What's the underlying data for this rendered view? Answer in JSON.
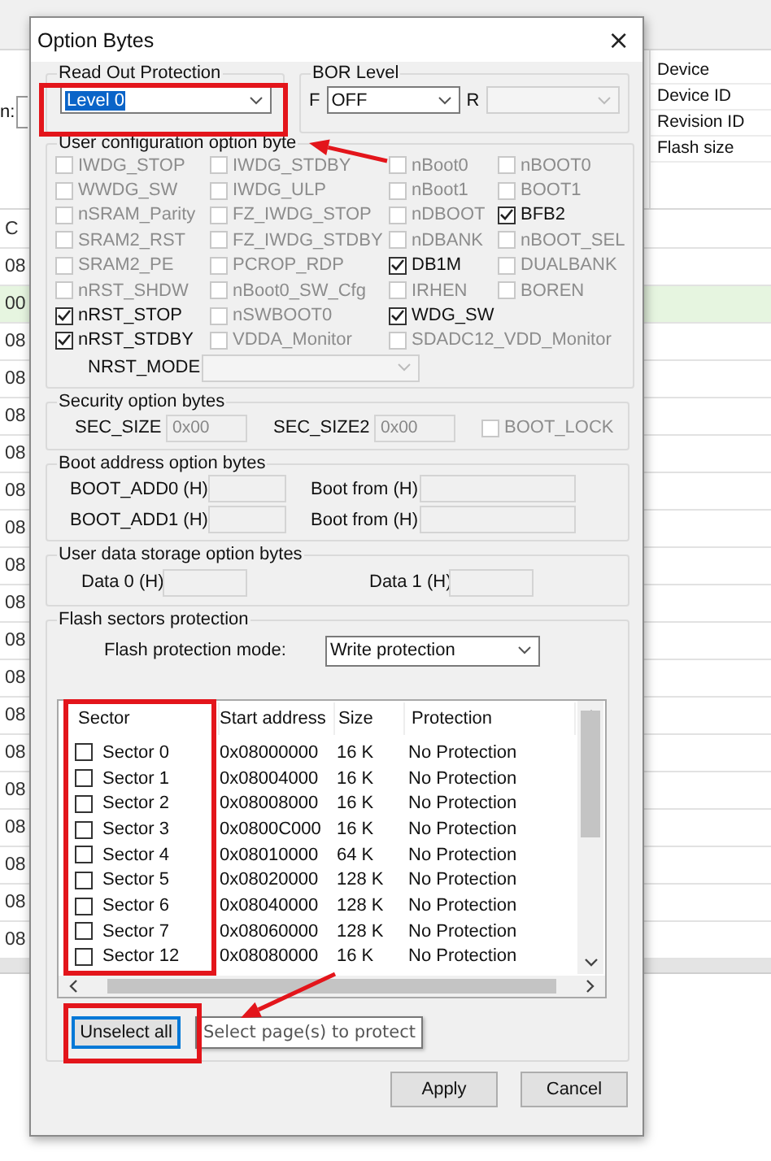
{
  "background_app": {
    "field_label": "n:",
    "column_header": "C",
    "rows": [
      {
        "text": "08",
        "selected": false
      },
      {
        "text": "00",
        "selected": true
      },
      {
        "text": "08",
        "selected": false
      },
      {
        "text": "08",
        "selected": false
      },
      {
        "text": "08",
        "selected": false
      },
      {
        "text": "08",
        "selected": false
      },
      {
        "text": "08",
        "selected": false
      },
      {
        "text": "08",
        "selected": false
      },
      {
        "text": "08",
        "selected": false
      },
      {
        "text": "08",
        "selected": false
      },
      {
        "text": "08",
        "selected": false
      },
      {
        "text": "08",
        "selected": false
      },
      {
        "text": "08",
        "selected": false
      },
      {
        "text": "08",
        "selected": false
      },
      {
        "text": "08",
        "selected": false
      },
      {
        "text": "08",
        "selected": false
      },
      {
        "text": "08",
        "selected": false
      },
      {
        "text": "08",
        "selected": false
      },
      {
        "text": "08",
        "selected": false
      }
    ],
    "info_labels": [
      "Device",
      "Device ID",
      "Revision ID",
      "Flash size"
    ]
  },
  "dialog": {
    "title": "Option Bytes",
    "close": "×",
    "read_out_protection": {
      "title": "Read Out Protection",
      "value": "Level 0",
      "highlighted": true
    },
    "bor_level": {
      "title": "BOR Level",
      "f_label": "F",
      "f_value": "OFF",
      "r_label": "R",
      "r_disabled": true
    },
    "user_configuration": {
      "title": "User configuration option byte",
      "arrow_marked": true,
      "option_rows": [
        [
          {
            "label": "IWDG_STOP",
            "checked": false,
            "disabled": true
          },
          {
            "label": "IWDG_STDBY",
            "checked": false,
            "disabled": true
          },
          {
            "label": "nBoot0",
            "checked": false,
            "disabled": true
          },
          {
            "label": "nBOOT0",
            "checked": false,
            "disabled": true
          }
        ],
        [
          {
            "label": "WWDG_SW",
            "checked": false,
            "disabled": true
          },
          {
            "label": "IWDG_ULP",
            "checked": false,
            "disabled": true
          },
          {
            "label": "nBoot1",
            "checked": false,
            "disabled": true
          },
          {
            "label": "BOOT1",
            "checked": false,
            "disabled": true
          }
        ],
        [
          {
            "label": "nSRAM_Parity",
            "checked": false,
            "disabled": true
          },
          {
            "label": "FZ_IWDG_STOP",
            "checked": false,
            "disabled": true
          },
          {
            "label": "nDBOOT",
            "checked": false,
            "disabled": true
          },
          {
            "label": "BFB2",
            "checked": true,
            "disabled": false
          }
        ],
        [
          {
            "label": "SRAM2_RST",
            "checked": false,
            "disabled": true
          },
          {
            "label": "FZ_IWDG_STDBY",
            "checked": false,
            "disabled": true
          },
          {
            "label": "nDBANK",
            "checked": false,
            "disabled": true
          },
          {
            "label": "nBOOT_SEL",
            "checked": false,
            "disabled": true
          }
        ],
        [
          {
            "label": "SRAM2_PE",
            "checked": false,
            "disabled": true
          },
          {
            "label": "PCROP_RDP",
            "checked": false,
            "disabled": true
          },
          {
            "label": "DB1M",
            "checked": true,
            "disabled": false
          },
          {
            "label": "DUALBANK",
            "checked": false,
            "disabled": true
          }
        ],
        [
          {
            "label": "nRST_SHDW",
            "checked": false,
            "disabled": true
          },
          {
            "label": "nBoot0_SW_Cfg",
            "checked": false,
            "disabled": true
          },
          {
            "label": "IRHEN",
            "checked": false,
            "disabled": true
          },
          {
            "label": "BOREN",
            "checked": false,
            "disabled": true
          }
        ],
        [
          {
            "label": "nRST_STOP",
            "checked": true,
            "disabled": false
          },
          {
            "label": "nSWBOOT0",
            "checked": false,
            "disabled": true
          },
          {
            "label": "WDG_SW",
            "checked": true,
            "disabled": false
          }
        ],
        [
          {
            "label": "nRST_STDBY",
            "checked": true,
            "disabled": false
          },
          {
            "label": "VDDA_Monitor",
            "checked": false,
            "disabled": true
          },
          {
            "label": "SDADC12_VDD_Monitor",
            "checked": false,
            "disabled": true
          }
        ]
      ],
      "nrst_mode_label": "NRST_MODE",
      "nrst_mode_disabled": true
    },
    "security": {
      "title": "Security option bytes",
      "sec_size_label": "SEC_SIZE",
      "sec_size": "0x00",
      "sec_size2_label": "SEC_SIZE2",
      "sec_size2": "0x00",
      "boot_lock": {
        "label": "BOOT_LOCK",
        "checked": false,
        "disabled": true
      }
    },
    "boot_address": {
      "title": "Boot address option bytes",
      "rows": [
        {
          "label": "BOOT_ADD0 (H)",
          "from_label": "Boot from (H)"
        },
        {
          "label": "BOOT_ADD1 (H)",
          "from_label": "Boot from (H)"
        }
      ]
    },
    "user_data": {
      "title": "User data storage option bytes",
      "data0_label": "Data 0 (H)",
      "data1_label": "Data 1 (H)"
    },
    "flash_protection": {
      "title": "Flash sectors protection",
      "mode_label": "Flash protection mode:",
      "mode_value": "Write protection",
      "columns": [
        "Sector",
        "Start address",
        "Size",
        "Protection"
      ],
      "sector_column_highlighted": true,
      "sectors": [
        {
          "name": "Sector 0",
          "start": "0x08000000",
          "size": "16 K",
          "protection": "No Protection",
          "checked": false
        },
        {
          "name": "Sector 1",
          "start": "0x08004000",
          "size": "16 K",
          "protection": "No Protection",
          "checked": false
        },
        {
          "name": "Sector 2",
          "start": "0x08008000",
          "size": "16 K",
          "protection": "No Protection",
          "checked": false
        },
        {
          "name": "Sector 3",
          "start": "0x0800C000",
          "size": "16 K",
          "protection": "No Protection",
          "checked": false
        },
        {
          "name": "Sector 4",
          "start": "0x08010000",
          "size": "64 K",
          "protection": "No Protection",
          "checked": false
        },
        {
          "name": "Sector 5",
          "start": "0x08020000",
          "size": "128 K",
          "protection": "No Protection",
          "checked": false
        },
        {
          "name": "Sector 6",
          "start": "0x08040000",
          "size": "128 K",
          "protection": "No Protection",
          "checked": false
        },
        {
          "name": "Sector 7",
          "start": "0x08060000",
          "size": "128 K",
          "protection": "No Protection",
          "checked": false
        },
        {
          "name": "Sector 12",
          "start": "0x08080000",
          "size": "16 K",
          "protection": "No Protection",
          "checked": false
        }
      ],
      "unselect_button": "Unselect all",
      "unselect_highlighted": true,
      "tooltip": "Select page(s) to protect",
      "tooltip_arrow_marked": true
    },
    "buttons": [
      "Apply",
      "Cancel"
    ]
  }
}
